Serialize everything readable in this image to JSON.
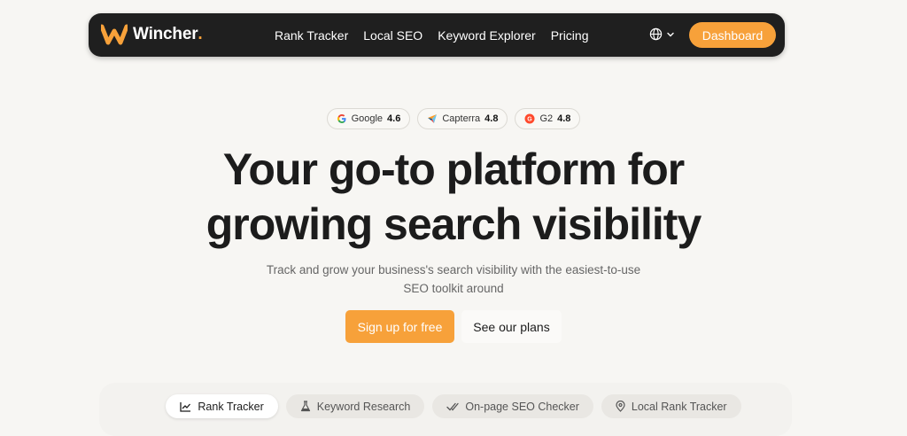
{
  "nav": {
    "brand": "Wincher",
    "brand_dot": ".",
    "links": [
      "Rank Tracker",
      "Local SEO",
      "Keyword Explorer",
      "Pricing"
    ],
    "language_icon": "globe-icon",
    "dashboard_label": "Dashboard"
  },
  "ratings": [
    {
      "name": "Google",
      "score": "4.6",
      "icon": "google-icon"
    },
    {
      "name": "Capterra",
      "score": "4.8",
      "icon": "capterra-icon"
    },
    {
      "name": "G2",
      "score": "4.8",
      "icon": "g2-icon"
    }
  ],
  "hero": {
    "title_line1": "Your go-to platform for",
    "title_line2": "growing search visibility",
    "subtitle_line1": "Track and grow your business's search visibility with the easiest-to-use",
    "subtitle_line2": "SEO toolkit around",
    "primary_cta": "Sign up for free",
    "secondary_cta": "See our plans"
  },
  "tabs": [
    {
      "label": "Rank Tracker",
      "icon": "chart-line-icon",
      "active": true
    },
    {
      "label": "Keyword Research",
      "icon": "flask-icon",
      "active": false
    },
    {
      "label": "On-page SEO Checker",
      "icon": "double-check-icon",
      "active": false
    },
    {
      "label": "Local Rank Tracker",
      "icon": "location-pin-icon",
      "active": false
    }
  ],
  "colors": {
    "accent": "#f7a13a",
    "nav_bg": "#1f1f1f",
    "page_bg": "#f7f6f3"
  }
}
